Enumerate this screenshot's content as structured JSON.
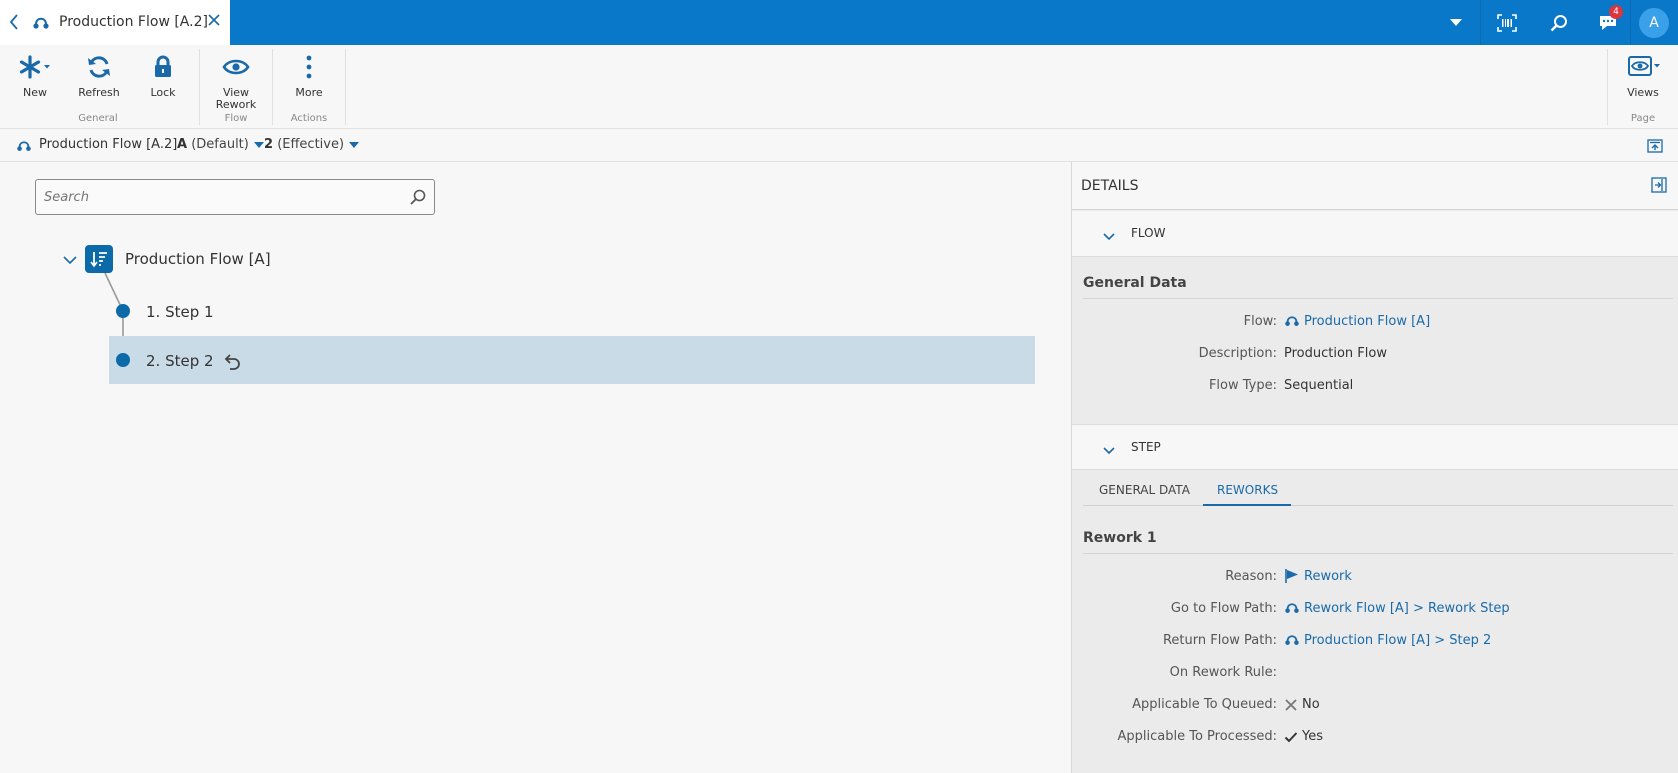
{
  "topbar": {
    "tab_title": "Production Flow [A.2]",
    "notification_count": "4",
    "avatar_initial": "A"
  },
  "ribbon": {
    "buttons": [
      {
        "label": "New",
        "icon": "asterisk-icon"
      },
      {
        "label": "Refresh",
        "icon": "refresh-icon"
      },
      {
        "label": "Lock",
        "icon": "lock-icon"
      },
      {
        "label_line1": "View",
        "label_line2": "Rework",
        "icon": "eye-icon"
      },
      {
        "label": "More",
        "icon": "more-vertical-icon"
      },
      {
        "label": "Views",
        "icon": "eye-icon"
      }
    ],
    "groups": {
      "general": "General",
      "flow": "Flow",
      "actions": "Actions",
      "page": "Page"
    }
  },
  "breadcrumb": {
    "title": "Production Flow [A.2]",
    "revision": "A",
    "revision_note": "(Default)",
    "version": "2",
    "version_note": "(Effective)"
  },
  "search": {
    "placeholder": "Search"
  },
  "tree": {
    "root": "Production Flow [A]",
    "steps": [
      {
        "label": "1. Step 1"
      },
      {
        "label": "2. Step 2",
        "selected": true
      }
    ]
  },
  "details": {
    "title": "DETAILS",
    "flow_section": "FLOW",
    "flow_general_title": "General Data",
    "flow_fields": {
      "flow_label": "Flow:",
      "flow_value": "Production Flow [A]",
      "description_label": "Description:",
      "description_value": "Production Flow",
      "type_label": "Flow Type:",
      "type_value": "Sequential"
    },
    "step_section": "STEP",
    "step_tabs": [
      "GENERAL DATA",
      "REWORKS"
    ],
    "active_tab": "REWORKS",
    "rework_title": "Rework 1",
    "rework_fields": {
      "reason_label": "Reason:",
      "reason_value": "Rework",
      "goto_label": "Go to Flow Path:",
      "goto_value": "Rework Flow [A] > Rework Step",
      "return_label": "Return Flow Path:",
      "return_value": "Production Flow [A] > Step 2",
      "rule_label": "On Rework Rule:",
      "queued_label": "Applicable To Queued:",
      "queued_value": "No",
      "processed_label": "Applicable To Processed:",
      "processed_value": "Yes"
    }
  },
  "colors": {
    "brand_blue": "#0a78c8",
    "link_blue": "#1a6aaa",
    "selection": "#c8dbe6",
    "badge_red": "#d9363e"
  }
}
